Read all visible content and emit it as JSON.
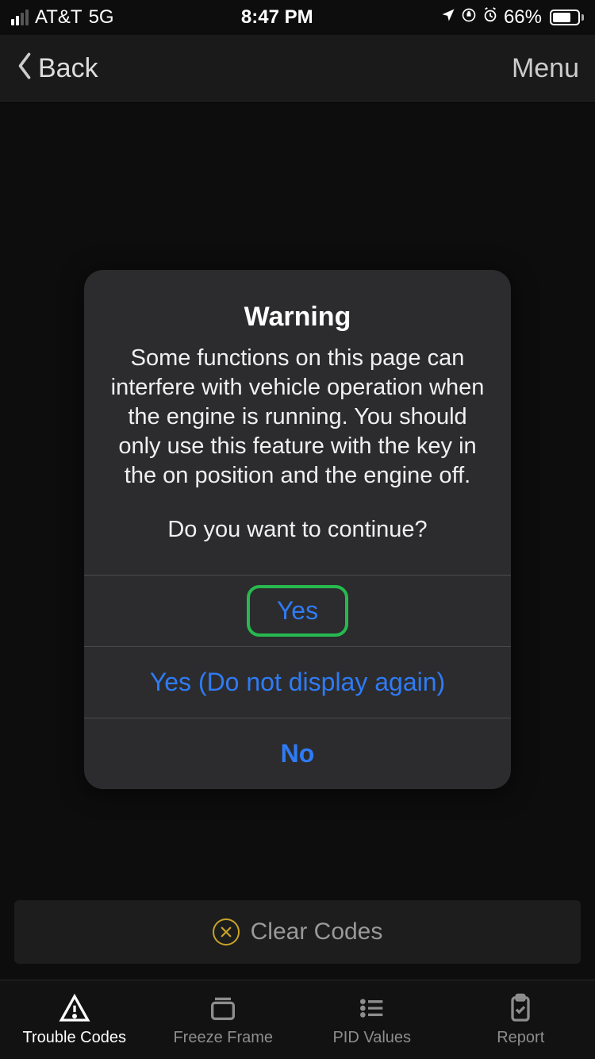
{
  "status": {
    "carrier": "AT&T",
    "network": "5G",
    "time": "8:47 PM",
    "battery_pct": "66%"
  },
  "nav": {
    "back_label": "Back",
    "menu_label": "Menu"
  },
  "modal": {
    "title": "Warning",
    "body_p1": "Some functions on this page can interfere with vehicle operation when the engine is running. You should only use this feature with the key in the on position and the engine off.",
    "body_p2": "Do you want to continue?",
    "actions": {
      "yes": "Yes",
      "yes_never": "Yes (Do not display again)",
      "no": "No"
    }
  },
  "clear_codes_label": "Clear Codes",
  "tabs": {
    "trouble_codes": "Trouble Codes",
    "freeze_frame": "Freeze Frame",
    "pid_values": "PID Values",
    "report": "Report"
  }
}
